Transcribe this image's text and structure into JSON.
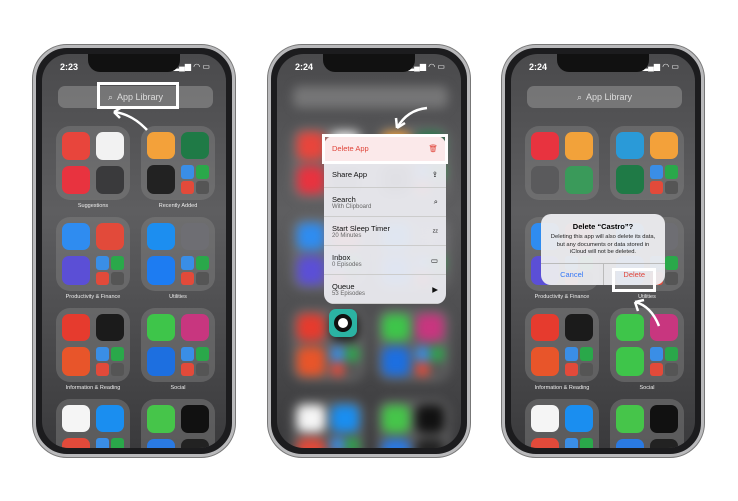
{
  "phones": [
    {
      "time": "2:23",
      "search": "App Library",
      "folders": [
        {
          "label": "Suggestions",
          "apps": [
            "#e8453c",
            "#f2f2f2",
            "#e8333f",
            "#3a3a3c"
          ],
          "small": false
        },
        {
          "label": "Recently Added",
          "apps": [
            "#f3a13a",
            "#1f7a46",
            "#222222",
            "#2a2a2a"
          ],
          "small": true
        },
        {
          "label": "Productivity & Finance",
          "apps": [
            "#2f8cf0",
            "#e24a3a",
            "#5b4fd6",
            "#2a2a2a"
          ],
          "small": true
        },
        {
          "label": "Utilities",
          "apps": [
            "#1c8ef0",
            "#6e6e73",
            "#1d7cf2",
            "#333333"
          ],
          "small": true
        },
        {
          "label": "Information & Reading",
          "apps": [
            "#e63b2e",
            "#1b1b1b",
            "#e8552a",
            "#6a6a6a"
          ],
          "small": true
        },
        {
          "label": "Social",
          "apps": [
            "#3ec54a",
            "#c8367f",
            "#1d6fe0",
            "#2aa84a"
          ],
          "small": true
        },
        {
          "label": "",
          "apps": [
            "#f5f5f5",
            "#1a8ef0",
            "#e24a3a",
            "#a04a2a"
          ],
          "small": true
        },
        {
          "label": "",
          "apps": [
            "#46c54a",
            "#111111",
            "#2a7ae2",
            "#222222"
          ],
          "small": false
        }
      ]
    },
    {
      "time": "2:24",
      "search": "",
      "folders": [
        {
          "label": "",
          "apps": [
            "#e8453c",
            "#f2f2f2",
            "#e8333f",
            "#3a3a3c"
          ],
          "small": false
        },
        {
          "label": "",
          "apps": [
            "#f3a13a",
            "#1f7a46",
            "#222222",
            "#2a2a2a"
          ],
          "small": true
        },
        {
          "label": "",
          "apps": [
            "#2f8cf0",
            "#e24a3a",
            "#5b4fd6",
            "#2a2a2a"
          ],
          "small": true
        },
        {
          "label": "",
          "apps": [
            "#1c8ef0",
            "#6e6e73",
            "#1d7cf2",
            "#333333"
          ],
          "small": true
        },
        {
          "label": "",
          "apps": [
            "#e63b2e",
            "#1b1b1b",
            "#e8552a",
            "#6a6a6a"
          ],
          "small": true
        },
        {
          "label": "",
          "apps": [
            "#3ec54a",
            "#c8367f",
            "#1d6fe0",
            "#2aa84a"
          ],
          "small": true
        },
        {
          "label": "",
          "apps": [
            "#f5f5f5",
            "#1a8ef0",
            "#e24a3a",
            "#a04a2a"
          ],
          "small": true
        },
        {
          "label": "",
          "apps": [
            "#46c54a",
            "#111111",
            "#2a7ae2",
            "#222222"
          ],
          "small": false
        }
      ]
    },
    {
      "time": "2:24",
      "search": "App Library",
      "folders": [
        {
          "label": "",
          "apps": [
            "#e8333f",
            "#f2a23a",
            "#5a5a5c",
            "#3a9a5a"
          ],
          "small": false
        },
        {
          "label": "",
          "apps": [
            "#2a9ad8",
            "#f3a13a",
            "#1f7a46",
            "#2a2a2a"
          ],
          "small": true
        },
        {
          "label": "Productivity & Finance",
          "apps": [
            "#2f8cf0",
            "#e24a3a",
            "#5b4fd6",
            "#2a2a2a"
          ],
          "small": true
        },
        {
          "label": "Utilities",
          "apps": [
            "#1c8ef0",
            "#6e6e73",
            "#1d7cf2",
            "#333333"
          ],
          "small": true
        },
        {
          "label": "Information & Reading",
          "apps": [
            "#e63b2e",
            "#1b1b1b",
            "#e8552a",
            "#6a6a6a"
          ],
          "small": true
        },
        {
          "label": "Social",
          "apps": [
            "#3ec54a",
            "#c8367f",
            "#3ec54a",
            "#2aa84a"
          ],
          "small": true
        },
        {
          "label": "",
          "apps": [
            "#f5f5f5",
            "#1a8ef0",
            "#e24a3a",
            "#a04a2a"
          ],
          "small": true
        },
        {
          "label": "",
          "apps": [
            "#46c54a",
            "#111111",
            "#2a7ae2",
            "#222222"
          ],
          "small": false
        }
      ]
    }
  ],
  "menu": {
    "items": [
      {
        "label": "Delete App",
        "sub": "",
        "icon": "🗑"
      },
      {
        "label": "Share App",
        "sub": "",
        "icon": "⇪"
      },
      {
        "label": "Search",
        "sub": "With Clipboard",
        "icon": "⌕"
      },
      {
        "label": "Start Sleep Timer",
        "sub": "20 Minutes",
        "icon": "ᶻᶻ"
      },
      {
        "label": "Inbox",
        "sub": "0 Episodes",
        "icon": "▭"
      },
      {
        "label": "Queue",
        "sub": "53 Episodes",
        "icon": "▶"
      }
    ]
  },
  "dialog": {
    "title": "Delete “Castro”?",
    "message": "Deleting this app will also delete its data, but any documents or data stored in iCloud will not be deleted.",
    "cancel": "Cancel",
    "delete": "Delete"
  },
  "colors": {
    "destructive": "#e0453a",
    "link": "#3478f6"
  }
}
